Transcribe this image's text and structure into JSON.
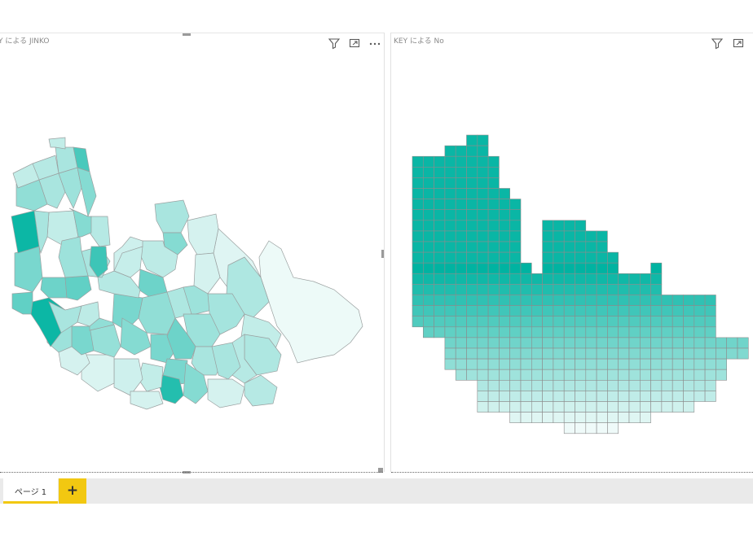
{
  "left_visual": {
    "title": "Y による JINKO",
    "header_icons": [
      "filter-icon",
      "focus-mode-icon",
      "more-options-icon"
    ]
  },
  "right_visual": {
    "title": "KEY による No",
    "header_icons": [
      "filter-icon",
      "focus-mode-icon"
    ]
  },
  "colors": {
    "map_high": "#00b3a1",
    "map_low": "#f2fbfa",
    "map_border": "#9aa0a0",
    "grid_border": "#8c8c8c",
    "tab_accent": "#f2c811",
    "tab_bar": "#eaeaea"
  },
  "pages": {
    "tabs": [
      {
        "label": "ページ 1"
      }
    ],
    "add_label": "+"
  }
}
